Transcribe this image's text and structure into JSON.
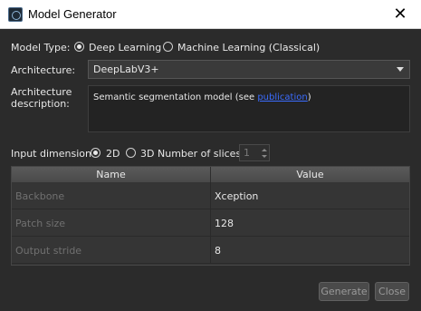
{
  "window": {
    "title": "Model Generator",
    "close_glyph": "✕"
  },
  "model_type": {
    "label": "Model Type:",
    "options": [
      {
        "label": "Deep Learning",
        "checked": true
      },
      {
        "label": "Machine Learning (Classical)",
        "checked": false
      }
    ]
  },
  "architecture": {
    "label": "Architecture:",
    "value": "DeepLabV3+"
  },
  "description": {
    "label_line1": "Architecture",
    "label_line2": "description:",
    "text_before": "Semantic segmentation model (see ",
    "link_text": "publication",
    "text_after": ")"
  },
  "input_dimension": {
    "label": "Input dimension:",
    "options": [
      {
        "label": "2D",
        "checked": true
      },
      {
        "label": "3D",
        "checked": false
      }
    ],
    "slices_label": "Number of slices:",
    "slices_value": "1"
  },
  "table": {
    "headers": [
      "Name",
      "Value"
    ],
    "rows": [
      {
        "name": "Backbone",
        "value": "Xception"
      },
      {
        "name": "Patch size",
        "value": "128"
      },
      {
        "name": "Output stride",
        "value": "8"
      }
    ]
  },
  "buttons": {
    "generate": "Generate",
    "close": "Close"
  }
}
